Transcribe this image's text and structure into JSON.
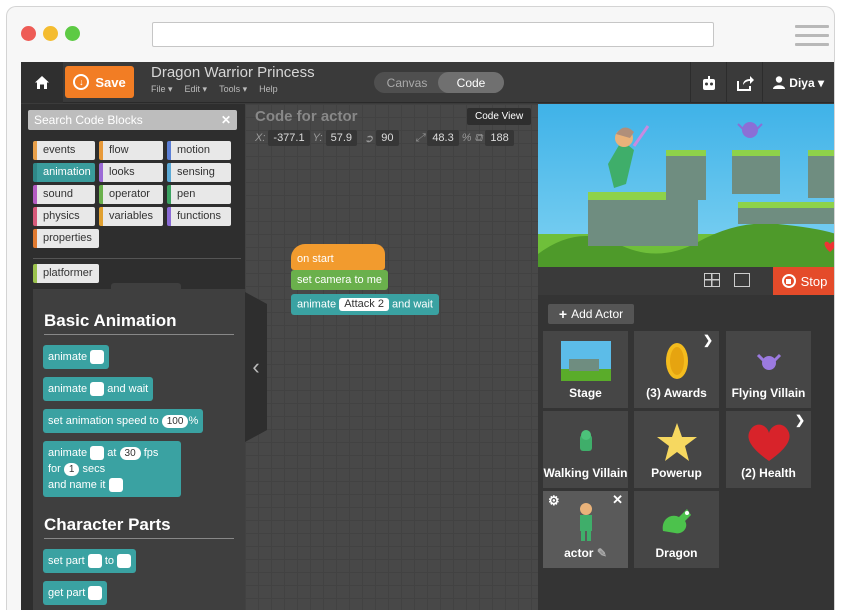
{
  "browser": {
    "dots": [
      "#ee5c56",
      "#f4bc30",
      "#5dca44"
    ]
  },
  "topbar": {
    "save_label": "Save",
    "project_title": "Dragon Warrior Princess",
    "menus": [
      "File ▾",
      "Edit ▾",
      "Tools ▾",
      "Help"
    ],
    "tabs": {
      "canvas": "Canvas",
      "code": "Code"
    },
    "user": "Diya ▾"
  },
  "palette": {
    "search_label": "Search Code Blocks",
    "categories": [
      {
        "label": "events",
        "color": "#e8a04a"
      },
      {
        "label": "flow",
        "color": "#e89a3a"
      },
      {
        "label": "motion",
        "color": "#5b7fd6"
      },
      {
        "label": "animation",
        "color": "#3aa2a2"
      },
      {
        "label": "looks",
        "color": "#9b6ad6"
      },
      {
        "label": "sensing",
        "color": "#5ba9d6"
      },
      {
        "label": "sound",
        "color": "#b45cc2"
      },
      {
        "label": "operator",
        "color": "#6ab04c"
      },
      {
        "label": "pen",
        "color": "#3aa260"
      },
      {
        "label": "physics",
        "color": "#d65a7a"
      },
      {
        "label": "variables",
        "color": "#e0a030"
      },
      {
        "label": "functions",
        "color": "#8a6ad6"
      },
      {
        "label": "properties",
        "color": "#e07a30"
      }
    ],
    "extension": "platformer",
    "sections": {
      "basic": "Basic Animation",
      "character": "Character Parts"
    },
    "blocks": {
      "animate": "animate",
      "animate_wait_a": "animate",
      "animate_wait_b": "and wait",
      "set_speed_a": "set animation speed to",
      "set_speed_val": "100",
      "set_speed_b": "%",
      "anim_fps_1": "animate",
      "anim_fps_2": "at",
      "anim_fps_val": "30",
      "anim_fps_3": "fps",
      "anim_for": "for",
      "anim_for_val": "1",
      "anim_secs": "secs",
      "anim_name": "and name it",
      "set_part_a": "set part",
      "set_part_b": "to",
      "get_part": "get part"
    }
  },
  "code": {
    "title": "Code for actor",
    "code_view_button": "Code View",
    "x_label": "X:",
    "x": "-377.1",
    "y_label": "Y:",
    "y": "57.9",
    "rotation": "90",
    "scale": "48.3",
    "scale_unit": "%",
    "depth": "188",
    "script": {
      "on_start": "on start",
      "set_camera": "set camera to me",
      "animate": "animate",
      "animation_name": "Attack 2",
      "and_wait": "and wait"
    }
  },
  "stage": {
    "stop_label": "Stop"
  },
  "actors": {
    "add_label": "Add Actor",
    "items": [
      {
        "label": "Stage"
      },
      {
        "label": "(3) Awards"
      },
      {
        "label": "Flying Villain"
      },
      {
        "label": "Walking Villain"
      },
      {
        "label": "Powerup"
      },
      {
        "label": "(2) Health"
      },
      {
        "label": "actor"
      },
      {
        "label": "Dragon"
      }
    ]
  }
}
